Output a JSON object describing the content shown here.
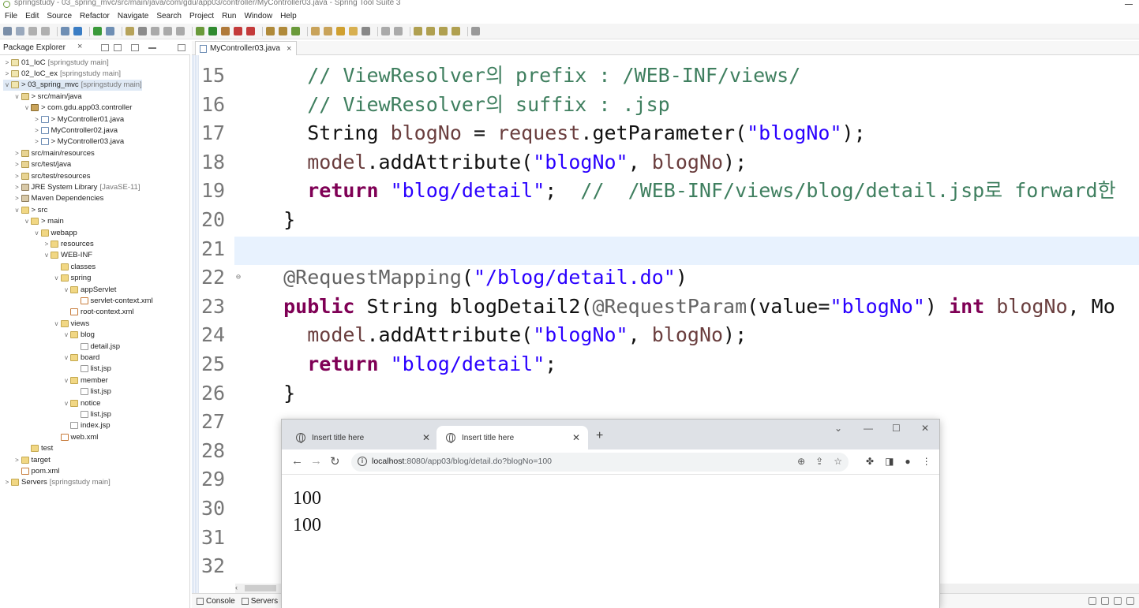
{
  "window": {
    "title": "springstudy - 03_spring_mvc/src/main/java/com/gdu/app03/controller/MyController03.java - Spring Tool Suite 3"
  },
  "menu": [
    "File",
    "Edit",
    "Source",
    "Refactor",
    "Navigate",
    "Search",
    "Project",
    "Run",
    "Window",
    "Help"
  ],
  "explorer": {
    "tab_label": "Package Explorer",
    "tree": [
      {
        "label": "01_IoC",
        "deco": "[springstudy main]",
        "icon": "project",
        "indent": 0,
        "twisty": ">"
      },
      {
        "label": "02_IoC_ex",
        "deco": "[springstudy main]",
        "icon": "project",
        "indent": 0,
        "twisty": ">"
      },
      {
        "label": "> 03_spring_mvc",
        "deco": "[springstudy main]",
        "icon": "project",
        "indent": 0,
        "twisty": "v",
        "selected": true
      },
      {
        "label": "> src/main/java",
        "deco": "",
        "icon": "srcfolder",
        "indent": 1,
        "twisty": "v"
      },
      {
        "label": "> com.gdu.app03.controller",
        "deco": "",
        "icon": "package",
        "indent": 2,
        "twisty": "v"
      },
      {
        "label": "> MyController01.java",
        "deco": "",
        "icon": "java",
        "indent": 3,
        "twisty": ">"
      },
      {
        "label": "MyController02.java",
        "deco": "",
        "icon": "java",
        "indent": 3,
        "twisty": ">"
      },
      {
        "label": "> MyController03.java",
        "deco": "",
        "icon": "java",
        "indent": 3,
        "twisty": ">"
      },
      {
        "label": "src/main/resources",
        "deco": "",
        "icon": "srcfolder",
        "indent": 1,
        "twisty": ">"
      },
      {
        "label": "src/test/java",
        "deco": "",
        "icon": "srcfolder",
        "indent": 1,
        "twisty": ">"
      },
      {
        "label": "src/test/resources",
        "deco": "",
        "icon": "srcfolder",
        "indent": 1,
        "twisty": ">"
      },
      {
        "label": "JRE System Library",
        "deco": "[JavaSE-11]",
        "icon": "library",
        "indent": 1,
        "twisty": ">"
      },
      {
        "label": "Maven Dependencies",
        "deco": "",
        "icon": "library",
        "indent": 1,
        "twisty": ">"
      },
      {
        "label": "> src",
        "deco": "",
        "icon": "folder",
        "indent": 1,
        "twisty": "v"
      },
      {
        "label": "> main",
        "deco": "",
        "icon": "folder",
        "indent": 2,
        "twisty": "v"
      },
      {
        "label": "webapp",
        "deco": "",
        "icon": "folder",
        "indent": 3,
        "twisty": "v"
      },
      {
        "label": "resources",
        "deco": "",
        "icon": "folder",
        "indent": 4,
        "twisty": ">"
      },
      {
        "label": "WEB-INF",
        "deco": "",
        "icon": "folder",
        "indent": 4,
        "twisty": "v"
      },
      {
        "label": "classes",
        "deco": "",
        "icon": "folder",
        "indent": 5,
        "twisty": ""
      },
      {
        "label": "spring",
        "deco": "",
        "icon": "folder",
        "indent": 5,
        "twisty": "v"
      },
      {
        "label": "appServlet",
        "deco": "",
        "icon": "folder",
        "indent": 6,
        "twisty": "v"
      },
      {
        "label": "servlet-context.xml",
        "deco": "",
        "icon": "xml",
        "indent": 7,
        "twisty": ""
      },
      {
        "label": "root-context.xml",
        "deco": "",
        "icon": "xml",
        "indent": 6,
        "twisty": ""
      },
      {
        "label": "views",
        "deco": "",
        "icon": "folder",
        "indent": 5,
        "twisty": "v"
      },
      {
        "label": "blog",
        "deco": "",
        "icon": "folder",
        "indent": 6,
        "twisty": "v"
      },
      {
        "label": "detail.jsp",
        "deco": "",
        "icon": "file",
        "indent": 7,
        "twisty": ""
      },
      {
        "label": "board",
        "deco": "",
        "icon": "folder",
        "indent": 6,
        "twisty": "v"
      },
      {
        "label": "list.jsp",
        "deco": "",
        "icon": "file",
        "indent": 7,
        "twisty": ""
      },
      {
        "label": "member",
        "deco": "",
        "icon": "folder",
        "indent": 6,
        "twisty": "v"
      },
      {
        "label": "list.jsp",
        "deco": "",
        "icon": "file",
        "indent": 7,
        "twisty": ""
      },
      {
        "label": "notice",
        "deco": "",
        "icon": "folder",
        "indent": 6,
        "twisty": "v"
      },
      {
        "label": "list.jsp",
        "deco": "",
        "icon": "file",
        "indent": 7,
        "twisty": ""
      },
      {
        "label": "index.jsp",
        "deco": "",
        "icon": "file",
        "indent": 6,
        "twisty": ""
      },
      {
        "label": "web.xml",
        "deco": "",
        "icon": "xml",
        "indent": 5,
        "twisty": ""
      },
      {
        "label": "test",
        "deco": "",
        "icon": "folder",
        "indent": 2,
        "twisty": ""
      },
      {
        "label": "target",
        "deco": "",
        "icon": "folder",
        "indent": 1,
        "twisty": ">"
      },
      {
        "label": "pom.xml",
        "deco": "",
        "icon": "xml",
        "indent": 1,
        "twisty": ""
      },
      {
        "label": "Servers",
        "deco": "[springstudy main]",
        "icon": "folder",
        "indent": 0,
        "twisty": ">"
      }
    ]
  },
  "editor": {
    "tab_label": "MyController03.java",
    "lines": [
      {
        "no": "15",
        "tokens": [
          {
            "t": "    "
          },
          {
            "t": "// ViewResolver의 prefix : /WEB-INF/views/",
            "c": "cm"
          }
        ]
      },
      {
        "no": "16",
        "tokens": [
          {
            "t": "    "
          },
          {
            "t": "// ViewResolver의 suffix : .jsp",
            "c": "cm"
          }
        ]
      },
      {
        "no": "17",
        "tokens": [
          {
            "t": "    String "
          },
          {
            "t": "blogNo",
            "c": "vr"
          },
          {
            "t": " = "
          },
          {
            "t": "request",
            "c": "vr"
          },
          {
            "t": ".getParameter("
          },
          {
            "t": "\"blogNo\"",
            "c": "st"
          },
          {
            "t": ");"
          }
        ]
      },
      {
        "no": "18",
        "tokens": [
          {
            "t": "    "
          },
          {
            "t": "model",
            "c": "vr"
          },
          {
            "t": ".addAttribute("
          },
          {
            "t": "\"blogNo\"",
            "c": "st"
          },
          {
            "t": ", "
          },
          {
            "t": "blogNo",
            "c": "vr"
          },
          {
            "t": ");"
          }
        ]
      },
      {
        "no": "19",
        "tokens": [
          {
            "t": "    "
          },
          {
            "t": "return",
            "c": "kw"
          },
          {
            "t": " "
          },
          {
            "t": "\"blog/detail\"",
            "c": "st"
          },
          {
            "t": ";  "
          },
          {
            "t": "//  /WEB-INF/views/blog/detail.jsp로 forward한",
            "c": "cm"
          }
        ]
      },
      {
        "no": "20",
        "tokens": [
          {
            "t": "  }"
          }
        ]
      },
      {
        "no": "21",
        "tokens": [
          {
            "t": ""
          }
        ]
      },
      {
        "no": "22",
        "fold": true,
        "tokens": [
          {
            "t": "  "
          },
          {
            "t": "@RequestMapping",
            "c": "an"
          },
          {
            "t": "("
          },
          {
            "t": "\"/blog/detail.do\"",
            "c": "st"
          },
          {
            "t": ")"
          }
        ]
      },
      {
        "no": "23",
        "tokens": [
          {
            "t": "  "
          },
          {
            "t": "public",
            "c": "kw"
          },
          {
            "t": " String blogDetail2("
          },
          {
            "t": "@RequestParam",
            "c": "an"
          },
          {
            "t": "(value="
          },
          {
            "t": "\"blogNo\"",
            "c": "st"
          },
          {
            "t": ") "
          },
          {
            "t": "int",
            "c": "kw"
          },
          {
            "t": " "
          },
          {
            "t": "blogNo",
            "c": "vr"
          },
          {
            "t": ", Mo"
          }
        ]
      },
      {
        "no": "24",
        "tokens": [
          {
            "t": "    "
          },
          {
            "t": "model",
            "c": "vr"
          },
          {
            "t": ".addAttribute("
          },
          {
            "t": "\"blogNo\"",
            "c": "st"
          },
          {
            "t": ", "
          },
          {
            "t": "blogNo",
            "c": "vr"
          },
          {
            "t": ");"
          }
        ]
      },
      {
        "no": "25",
        "tokens": [
          {
            "t": "    "
          },
          {
            "t": "return",
            "c": "kw"
          },
          {
            "t": " "
          },
          {
            "t": "\"blog/detail\"",
            "c": "st"
          },
          {
            "t": ";"
          }
        ]
      },
      {
        "no": "26",
        "tokens": [
          {
            "t": "  }"
          }
        ]
      },
      {
        "no": "27",
        "tokens": [
          {
            "t": ""
          }
        ]
      },
      {
        "no": "28",
        "tokens": [
          {
            "t": ""
          }
        ]
      },
      {
        "no": "29",
        "tokens": [
          {
            "t": ""
          }
        ]
      },
      {
        "no": "30",
        "tokens": [
          {
            "t": ""
          }
        ]
      },
      {
        "no": "31",
        "tokens": [
          {
            "t": ""
          }
        ]
      },
      {
        "no": "32",
        "tokens": [
          {
            "t": ""
          }
        ]
      }
    ]
  },
  "bottom_views": {
    "console_label": "Console",
    "servers_label": "Servers"
  },
  "browser": {
    "tabs": [
      {
        "title": "Insert title here",
        "active": false
      },
      {
        "title": "Insert title here",
        "active": true
      }
    ],
    "url_host": "localhost",
    "url_rest": ":8080/app03/blog/detail.do?blogNo=100",
    "body_lines": [
      "100",
      "100"
    ],
    "icons": {
      "back": "arrow-left-icon",
      "forward": "arrow-right-icon",
      "reload": "reload-icon",
      "info": "info-icon",
      "zoom": "zoom-icon",
      "share": "share-icon",
      "bookmark": "star-icon",
      "extensions": "puzzle-icon",
      "sidepanel": "side-panel-icon",
      "profile": "profile-icon",
      "menu": "kebab-menu-icon"
    }
  }
}
